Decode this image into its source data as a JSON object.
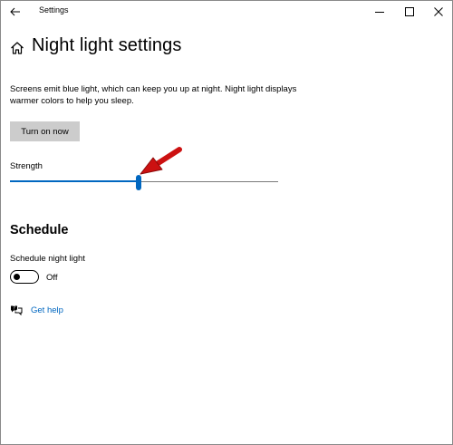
{
  "window": {
    "title": "Settings"
  },
  "header": {
    "title": "Night light settings"
  },
  "description": "Screens emit blue light, which can keep you up at night. Night light displays warmer colors to help you sleep.",
  "turn_on_button": {
    "label": "Turn on now"
  },
  "strength": {
    "label": "Strength",
    "value_percent": 48
  },
  "schedule": {
    "section_title": "Schedule",
    "toggle_label": "Schedule night light",
    "toggle_state": "Off"
  },
  "help": {
    "link_label": "Get help"
  },
  "icons": {
    "back": "back-arrow-icon",
    "minimize": "minimize-icon",
    "maximize": "maximize-icon",
    "close": "close-icon",
    "home": "home-icon",
    "help": "help-chat-icon"
  },
  "colors": {
    "accent": "#0067c0",
    "button_bg": "#cccccc",
    "annotation": "#cc1111"
  }
}
